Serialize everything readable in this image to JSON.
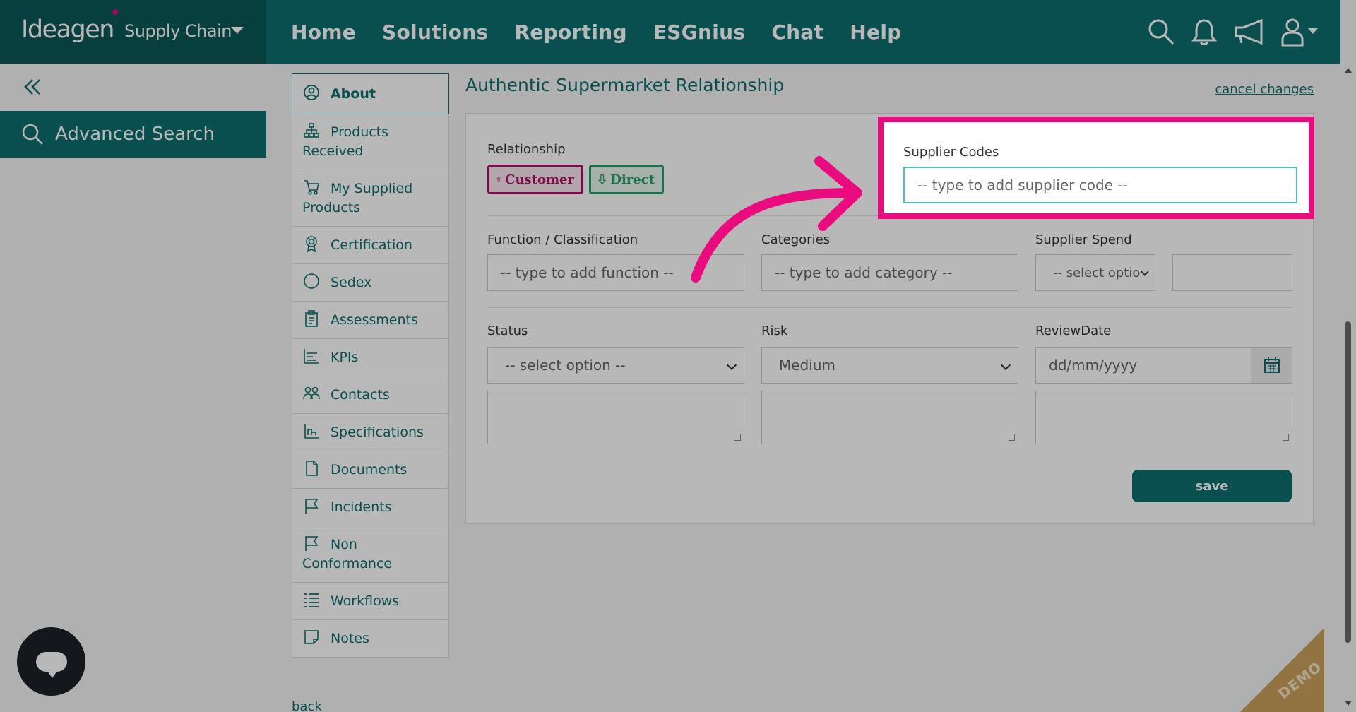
{
  "brand": {
    "logo_text": "Ideagen",
    "product": "Supply Chain"
  },
  "nav": {
    "items": [
      "Home",
      "Solutions",
      "Reporting",
      "ESGnius",
      "Chat",
      "Help"
    ]
  },
  "left": {
    "advanced_search": "Advanced Search"
  },
  "menu": {
    "items": [
      {
        "label": "About",
        "icon": "user-circle-icon"
      },
      {
        "label": "Products Received",
        "icon": "hierarchy-icon"
      },
      {
        "label": "My Supplied Products",
        "icon": "cart-icon"
      },
      {
        "label": "Certification",
        "icon": "award-icon"
      },
      {
        "label": "Sedex",
        "icon": "circle-icon"
      },
      {
        "label": "Assessments",
        "icon": "clipboard-icon"
      },
      {
        "label": "KPIs",
        "icon": "bar-chart-icon"
      },
      {
        "label": "Contacts",
        "icon": "people-icon"
      },
      {
        "label": "Specifications",
        "icon": "spec-icon"
      },
      {
        "label": "Documents",
        "icon": "document-icon"
      },
      {
        "label": "Incidents",
        "icon": "flag-icon"
      },
      {
        "label": "Non Conformance",
        "icon": "flag-icon"
      },
      {
        "label": "Workflows",
        "icon": "list-icon"
      },
      {
        "label": "Notes",
        "icon": "note-icon"
      }
    ],
    "back": "back"
  },
  "main": {
    "title": "Authentic Supermarket Relationship",
    "cancel": "cancel changes",
    "relationship": {
      "label": "Relationship",
      "customer": "Customer",
      "direct": "Direct"
    },
    "supplier_codes": {
      "label": "Supplier Codes",
      "placeholder": "-- type to add supplier code --"
    },
    "function": {
      "label": "Function / Classification",
      "placeholder": "-- type to add function --"
    },
    "categories": {
      "label": "Categories",
      "placeholder": "-- type to add category --"
    },
    "supplier_spend": {
      "label": "Supplier Spend",
      "value": "-- select optio"
    },
    "status": {
      "label": "Status",
      "value": "-- select option --"
    },
    "risk": {
      "label": "Risk",
      "value": "Medium"
    },
    "review_date": {
      "label": "ReviewDate",
      "placeholder": "dd/mm/yyyy"
    },
    "save": "save"
  },
  "demo": "DEMO",
  "colors": {
    "teal": "#0d6e6e",
    "highlight": "#ea0b7e",
    "customer": "#b0106a",
    "direct": "#22a06a"
  }
}
